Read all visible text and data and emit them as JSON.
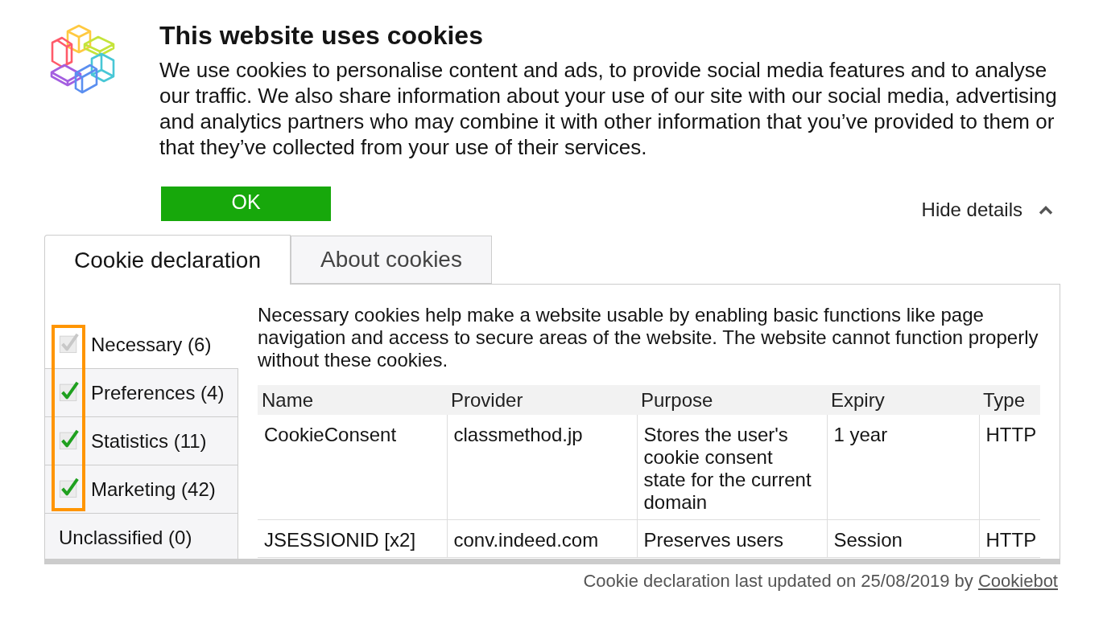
{
  "banner": {
    "title": "This website uses cookies",
    "text": "We use cookies to personalise content and ads, to provide social media features and to analyse our traffic. We also share information about your use of our site with our social media, advertising and analytics partners who may combine it with other information that you’ve provided to them or that they’ve collected from your use of their services."
  },
  "ok_button": "OK",
  "details_toggle": {
    "label": "Hide details",
    "expanded": true
  },
  "tabs": [
    {
      "label": "Cookie declaration",
      "selected": true
    },
    {
      "label": "About cookies",
      "selected": false
    }
  ],
  "categories": [
    {
      "label": "Necessary (6)",
      "kind": "checkbox",
      "checked": true,
      "disabled": true,
      "selected": true
    },
    {
      "label": "Preferences (4)",
      "kind": "checkbox",
      "checked": true,
      "disabled": false,
      "selected": false
    },
    {
      "label": "Statistics (11)",
      "kind": "checkbox",
      "checked": true,
      "disabled": false,
      "selected": false
    },
    {
      "label": "Marketing (42)",
      "kind": "checkbox",
      "checked": true,
      "disabled": false,
      "selected": false
    },
    {
      "label": "Unclassified (0)",
      "kind": "plain",
      "selected": false
    }
  ],
  "checkboxes_highlighted": true,
  "description": "Necessary cookies help make a website usable by enabling basic functions like page navigation and access to secure areas of the website. The website cannot function properly without these cookies.",
  "table": {
    "columns": [
      "Name",
      "Provider",
      "Purpose",
      "Expiry",
      "Type"
    ],
    "rows": [
      [
        "CookieConsent",
        "classmethod.jp",
        "Stores the user's cookie consent state for the current domain",
        "1 year",
        "HTTP"
      ],
      [
        "JSESSIONID [x2]",
        "conv.indeed.com",
        "Preserves users",
        "Session",
        "HTTP"
      ]
    ]
  },
  "footer": {
    "text": "Cookie declaration last updated on 25/08/2019 by",
    "link": "Cookiebot"
  }
}
